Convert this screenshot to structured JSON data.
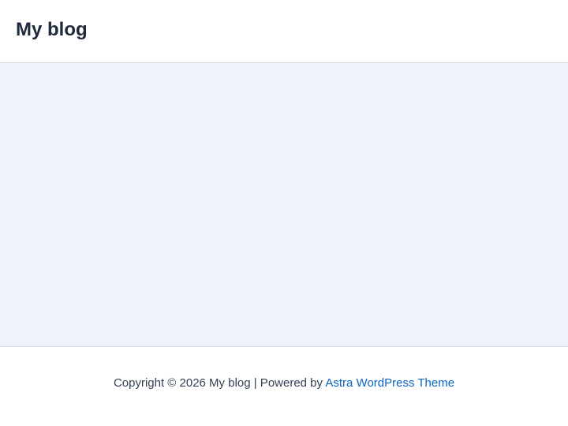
{
  "header": {
    "site_title": "My blog"
  },
  "footer": {
    "copyright_prefix": "Copyright © 2026 My blog | Powered by ",
    "theme_link": "Astra WordPress Theme"
  },
  "colors": {
    "content_background": "#eef3fb",
    "link": "#0a66c2",
    "title_text": "#1e293b"
  }
}
